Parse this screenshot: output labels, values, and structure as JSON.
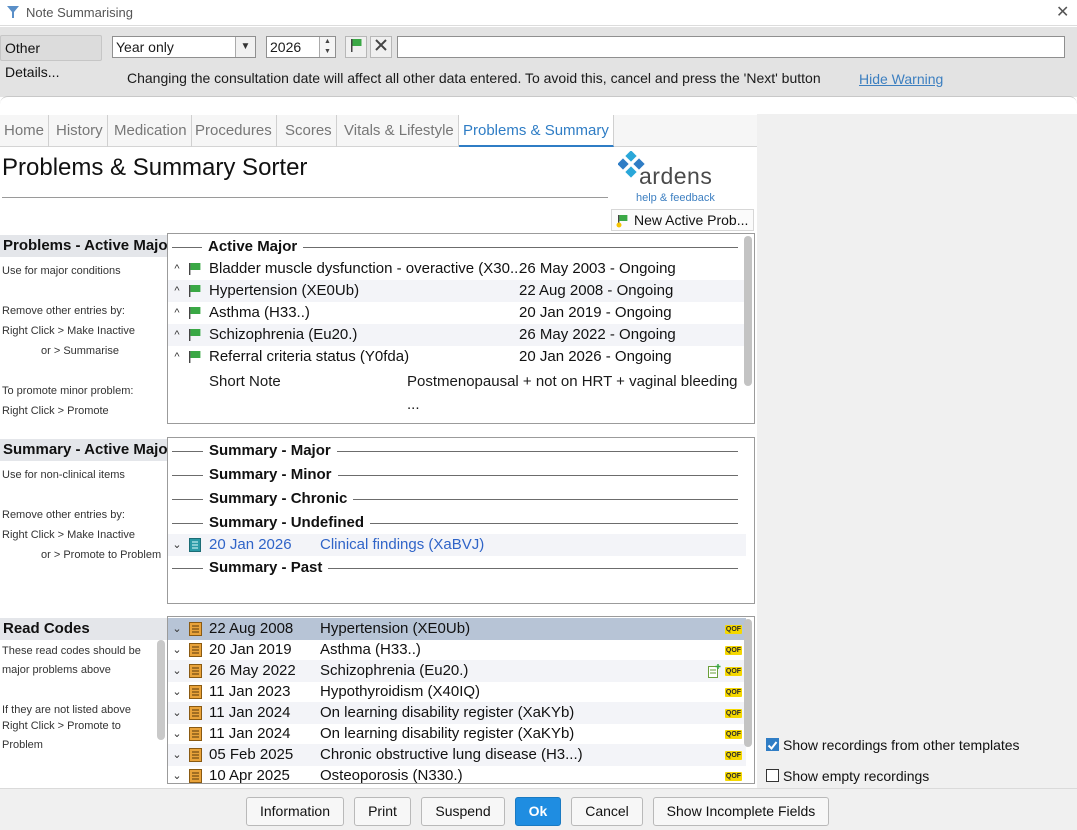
{
  "window": {
    "title": "Note Summarising"
  },
  "toolbar": {
    "other_details_label": "Other Details...",
    "date_precision": "Year only",
    "year": "2026",
    "notes_value": "",
    "warning": "Changing the consultation date will affect all other data entered. To avoid this, cancel and press the 'Next' button",
    "hide_warning_label": "Hide Warning"
  },
  "tabs": [
    {
      "label": "Home"
    },
    {
      "label": "History"
    },
    {
      "label": "Medication"
    },
    {
      "label": "Procedures"
    },
    {
      "label": "Scores"
    },
    {
      "label": "Vitals & Lifestyle"
    },
    {
      "label": "Problems & Summary"
    }
  ],
  "header": {
    "title": "Problems & Summary Sorter",
    "logo_text": "ardens",
    "help_link": "help & feedback",
    "new_problem_label": "New Active Prob..."
  },
  "sidebar": {
    "problems": {
      "heading": "Problems - Active Major",
      "notes": [
        "Use for major conditions",
        "Remove other entries by:",
        "Right Click > Make Inactive",
        "or > Summarise",
        "To promote minor problem:",
        "Right Click > Promote"
      ]
    },
    "summary": {
      "heading": "Summary - Active Major",
      "notes": [
        "Use for non-clinical items",
        "Remove other entries by:",
        "Right Click > Make Inactive",
        "or > Promote to Problem"
      ]
    },
    "read_codes": {
      "heading": "Read Codes",
      "notes": [
        "These read codes should be",
        "major problems above",
        "If they are not listed above",
        "Right Click > Promote to",
        "Problem"
      ]
    }
  },
  "problems_panel": {
    "group_label": "Active Major",
    "rows": [
      {
        "name": "Bladder muscle dysfunction - overactive (X30...",
        "date": "26 May 2003 - Ongoing"
      },
      {
        "name": "Hypertension (XE0Ub)",
        "date": "22 Aug 2008 - Ongoing"
      },
      {
        "name": "Asthma (H33..)",
        "date": "20 Jan 2019 - Ongoing"
      },
      {
        "name": "Schizophrenia (Eu20.)",
        "date": "26 May 2022 - Ongoing"
      },
      {
        "name": "Referral criteria status (Y0fda)",
        "date": "20 Jan 2026 - Ongoing"
      }
    ],
    "short_note_label": "Short Note",
    "short_note_value": "Postmenopausal + not on HRT + vaginal bleeding",
    "short_note_more": "..."
  },
  "summary_panel": {
    "groups": [
      "Summary - Major",
      "Summary - Minor",
      "Summary - Chronic",
      "Summary - Undefined",
      "Summary - Past"
    ],
    "undefined_row": {
      "date": "20 Jan 2026",
      "name": "Clinical findings (XaBVJ)"
    }
  },
  "read_codes_panel": {
    "badge": "QOF",
    "rows": [
      {
        "date": "22 Aug 2008",
        "name": "Hypertension (XE0Ub)"
      },
      {
        "date": "20 Jan 2019",
        "name": "Asthma (H33..)"
      },
      {
        "date": "26 May 2022",
        "name": "Schizophrenia (Eu20.)"
      },
      {
        "date": "11 Jan 2023",
        "name": "Hypothyroidism (X40IQ)"
      },
      {
        "date": "11 Jan 2024",
        "name": "On learning disability register (XaKYb)"
      },
      {
        "date": "11 Jan 2024",
        "name": "On learning disability register (XaKYb)"
      },
      {
        "date": "05 Feb 2025",
        "name": "Chronic obstructive lung disease (H3...)"
      },
      {
        "date": "10 Apr 2025",
        "name": "Osteoporosis (N330.)"
      }
    ]
  },
  "options": {
    "show_other_templates": {
      "label": "Show recordings from other templates",
      "checked": true
    },
    "show_empty": {
      "label": "Show empty recordings",
      "checked": false
    }
  },
  "footer": {
    "information": "Information",
    "print": "Print",
    "suspend": "Suspend",
    "ok": "Ok",
    "cancel": "Cancel",
    "show_incomplete": "Show Incomplete Fields"
  },
  "colors": {
    "accent": "#2f7dc5",
    "flag": "#3aa845",
    "qof": "#f5d800",
    "selected_row": "#b7c4d6"
  }
}
